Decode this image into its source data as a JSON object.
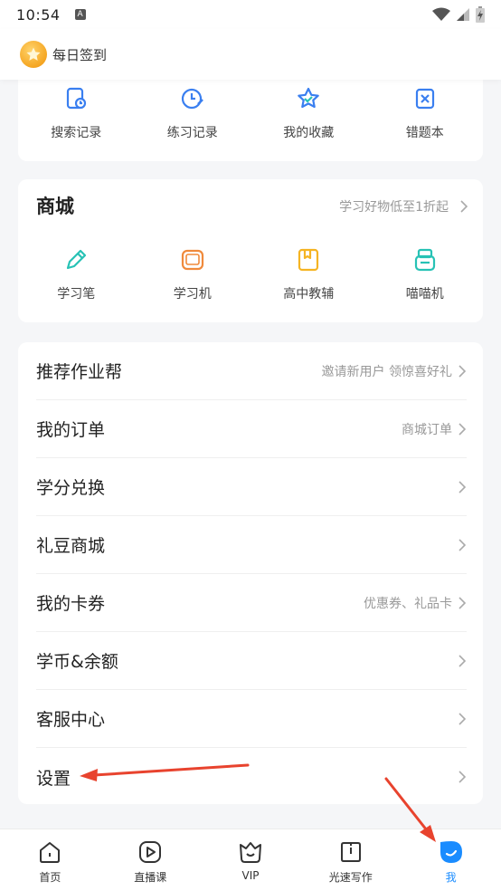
{
  "status_bar": {
    "time": "10:54",
    "badge": "A"
  },
  "header": {
    "sign_in_label": "每日签到"
  },
  "tools": [
    {
      "label": "搜索记录",
      "icon": "search-history-icon"
    },
    {
      "label": "练习记录",
      "icon": "practice-history-icon"
    },
    {
      "label": "我的收藏",
      "icon": "favorites-star-icon"
    },
    {
      "label": "错题本",
      "icon": "wrong-questions-icon"
    }
  ],
  "mall": {
    "title": "商城",
    "promo": "学习好物低至1折起",
    "items": [
      {
        "label": "学习笔",
        "icon": "pen-icon"
      },
      {
        "label": "学习机",
        "icon": "tablet-icon"
      },
      {
        "label": "高中教辅",
        "icon": "book-icon"
      },
      {
        "label": "喵喵机",
        "icon": "printer-icon"
      }
    ]
  },
  "menu": [
    {
      "label": "推荐作业帮",
      "hint": "邀请新用户 领惊喜好礼"
    },
    {
      "label": "我的订单",
      "hint": "商城订单"
    },
    {
      "label": "学分兑换",
      "hint": ""
    },
    {
      "label": "礼豆商城",
      "hint": ""
    },
    {
      "label": "我的卡券",
      "hint": "优惠券、礼品卡"
    },
    {
      "label": "学币&余额",
      "hint": ""
    },
    {
      "label": "客服中心",
      "hint": ""
    },
    {
      "label": "设置",
      "hint": ""
    }
  ],
  "bottom_nav": [
    {
      "label": "首页",
      "icon": "home-icon"
    },
    {
      "label": "直播课",
      "icon": "live-course-icon"
    },
    {
      "label": "VIP",
      "icon": "vip-icon"
    },
    {
      "label": "光速写作",
      "icon": "writing-icon"
    },
    {
      "label": "我",
      "icon": "me-icon"
    }
  ],
  "colors": {
    "accent": "#1a8cff",
    "icon_teal": "#27c2b5",
    "icon_blue": "#3a7ff0",
    "icon_orange": "#f08a3c",
    "icon_yellow": "#f5b423",
    "annotation_red": "#e8432e"
  }
}
